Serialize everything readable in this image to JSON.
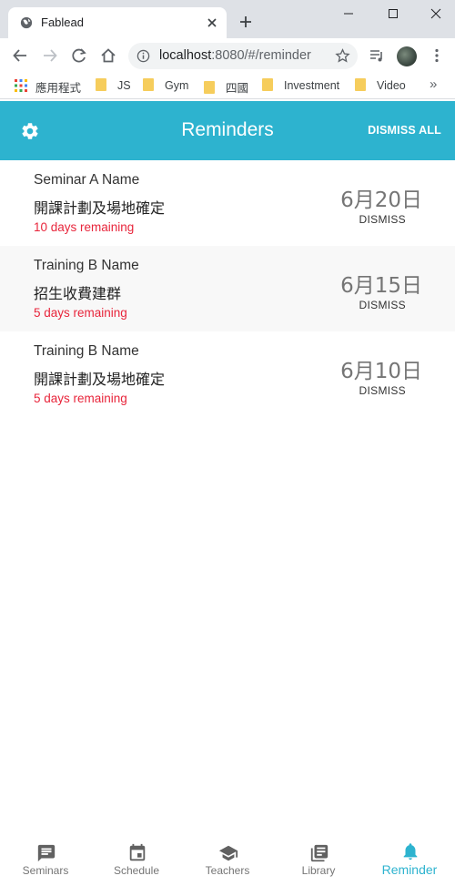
{
  "browser": {
    "tab_title": "Fablead",
    "url_host": "localhost",
    "url_rest": ":8080/#/reminder",
    "bookmarks": [
      {
        "label": "應用程式",
        "type": "apps"
      },
      {
        "label": "JS",
        "type": "folder"
      },
      {
        "label": "Gym",
        "type": "folder"
      },
      {
        "label": "四國",
        "type": "folder"
      },
      {
        "label": "Investment",
        "type": "folder"
      },
      {
        "label": "Video",
        "type": "folder"
      }
    ],
    "bookmarks_more": "»"
  },
  "header": {
    "title": "Reminders",
    "dismiss_all": "DISMISS ALL",
    "color": "#2db3cf"
  },
  "reminders": [
    {
      "name": "Seminar A Name",
      "task": "開課計劃及場地確定",
      "remaining": "10 days remaining",
      "date": "6月20日",
      "dismiss": "DISMISS"
    },
    {
      "name": "Training B Name",
      "task": "招生收費建群",
      "remaining": "5 days remaining",
      "date": "6月15日",
      "dismiss": "DISMISS"
    },
    {
      "name": "Training B Name",
      "task": "開課計劃及場地確定",
      "remaining": "5 days remaining",
      "date": "6月10日",
      "dismiss": "DISMISS"
    }
  ],
  "bottom_nav": [
    {
      "label": "Seminars",
      "icon": "chat-icon",
      "active": false
    },
    {
      "label": "Schedule",
      "icon": "calendar-icon",
      "active": false
    },
    {
      "label": "Teachers",
      "icon": "school-icon",
      "active": false
    },
    {
      "label": "Library",
      "icon": "library-icon",
      "active": false
    },
    {
      "label": "Reminder",
      "icon": "bell-icon",
      "active": true
    }
  ],
  "colors": {
    "accent": "#2db3cf",
    "remaining": "#e8253b",
    "alt_row": "#f8f8f8"
  }
}
